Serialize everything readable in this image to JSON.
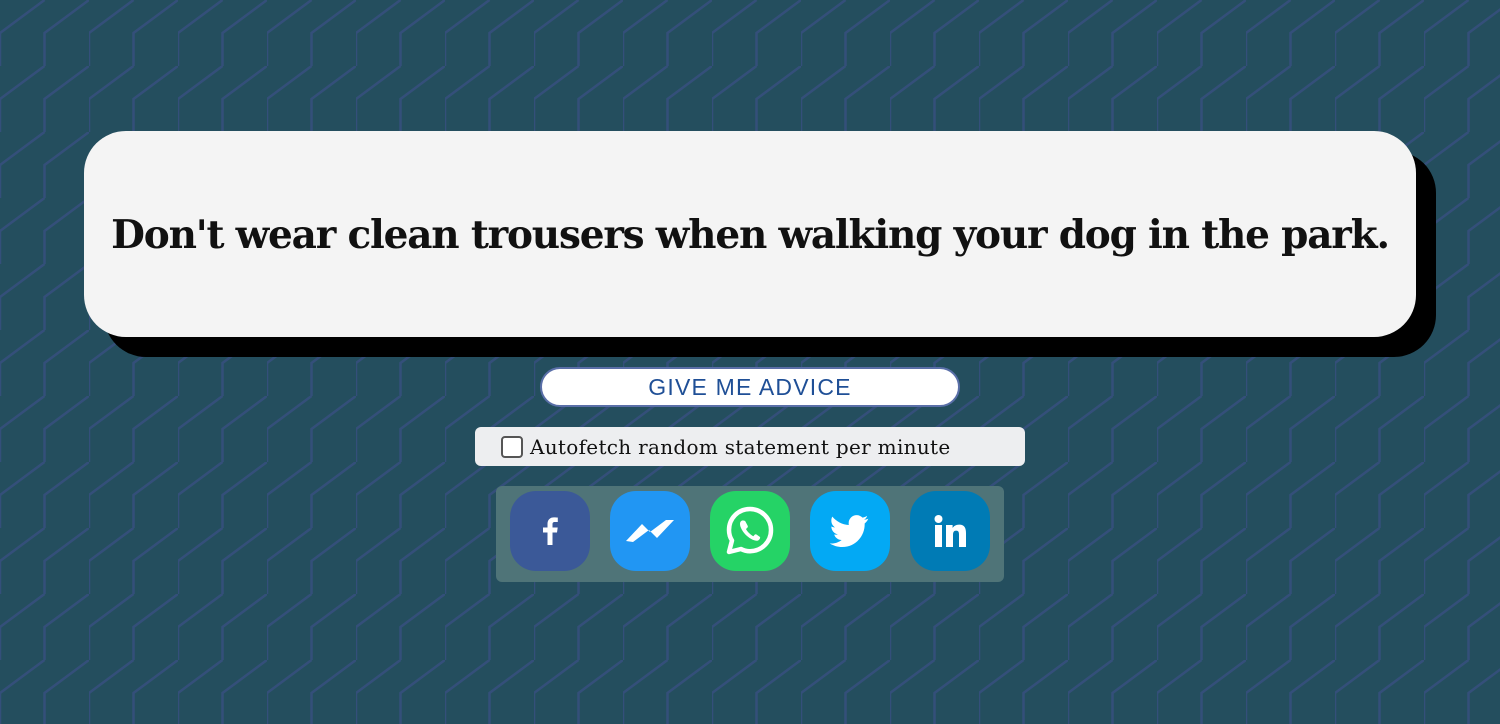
{
  "advice": {
    "text": "Don't wear clean trousers when walking your dog in the park."
  },
  "actions": {
    "advice_button_label": "GIVE ME ADVICE",
    "autofetch_label": "Autofetch random statement per minute",
    "autofetch_checked": false
  },
  "share": {
    "buttons": [
      {
        "icon": "facebook-icon",
        "color": "#3b5998"
      },
      {
        "icon": "messenger-icon",
        "color": "#2196f3"
      },
      {
        "icon": "whatsapp-icon",
        "color": "#25d366"
      },
      {
        "icon": "twitter-icon",
        "color": "#03a9f4"
      },
      {
        "icon": "linkedin-icon",
        "color": "#007bb5"
      }
    ]
  },
  "colors": {
    "background": "#244e5e",
    "pattern_stroke": "#344f7a",
    "card_background": "#f4f4f4",
    "card_shadow": "#000000",
    "button_text": "#1f4f96",
    "share_bar": "#4f7478"
  }
}
